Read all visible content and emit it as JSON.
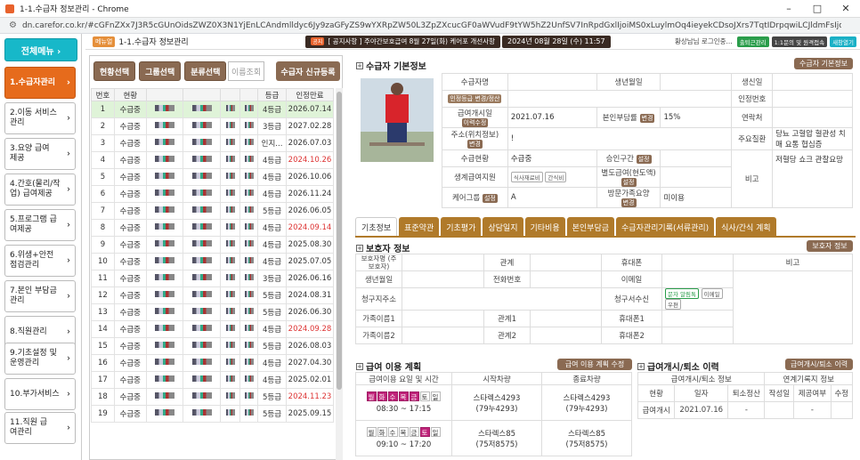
{
  "window": {
    "title": "1-1.수급자 정보관리 - Chrome",
    "url": "dn.carefor.co.kr/#cGFnZXx7J3R5cGUnOidsZWZ0X3N1YjEnLCAndmlldyc6Jy9zaGFyZS9wYXRpZW50L3ZpZXcucGF0aWVudF9tYW5hZ2UnfSV7InRpdGxlIjoiMS0xLuylmOq4ieyekCDsoJXrs7TqtIDrpqwiLCJldmFsIjoiNDciLCJnX3BhbW10nb..."
  },
  "sidebar": {
    "top_label": "전체메뉴 ›",
    "items": [
      {
        "label": "1.수급자관리",
        "active": true
      },
      {
        "label": "2.이동 서비스관리"
      },
      {
        "label": "3.요양 급여제공"
      },
      {
        "label": "4.간호(물리/작업) 급여제공"
      },
      {
        "label": "5.프로그램 급여제공"
      },
      {
        "label": "6.위생+안전 점검관리"
      },
      {
        "label": "7.본인 부담금관리"
      },
      {
        "label": "8.직원관리"
      },
      {
        "label": "9.기초설정 및 운영관리"
      },
      {
        "label": "10.부가서비스"
      },
      {
        "label": "11.직원 급여관리"
      }
    ]
  },
  "topbar": {
    "menu_badge": "메뉴얼",
    "title": "1-1.수급자 정보관리",
    "notice_icon": "공지",
    "notice": "[ 공지사항 ] 주야간보호급여 8월 27일(화) 케어포 개선사항",
    "clock": "2024년 08월 28일 (수) 11:57",
    "user": "황상남님 로그인중...",
    "btn1": "출퇴근관리",
    "btn2": "1:1문의 및 원격접속",
    "btn3": "새창열기"
  },
  "list": {
    "buttons": [
      "현황선택",
      "그룹선택",
      "분류선택"
    ],
    "search_placeholder": "이름조회",
    "new_button": "수급자 신규등록",
    "headers": [
      "번호",
      "현황",
      "",
      "",
      "",
      "",
      "등급",
      "인정만료"
    ],
    "rows": [
      {
        "no": "1",
        "status": "수급중",
        "grade": "4등급",
        "expire": "2026.07.14",
        "red": false
      },
      {
        "no": "2",
        "status": "수급중",
        "grade": "3등급",
        "expire": "2027.02.28",
        "red": false
      },
      {
        "no": "3",
        "status": "수급중",
        "grade": "인지...",
        "expire": "2026.07.03",
        "red": false
      },
      {
        "no": "4",
        "status": "수급중",
        "grade": "4등급",
        "expire": "2024.10.26",
        "red": true
      },
      {
        "no": "5",
        "status": "수급중",
        "grade": "4등급",
        "expire": "2026.10.06",
        "red": false
      },
      {
        "no": "6",
        "status": "수급중",
        "grade": "4등급",
        "expire": "2026.11.24",
        "red": false
      },
      {
        "no": "7",
        "status": "수급중",
        "grade": "5등급",
        "expire": "2026.06.05",
        "red": false
      },
      {
        "no": "8",
        "status": "수급중",
        "grade": "4등급",
        "expire": "2024.09.14",
        "red": true
      },
      {
        "no": "9",
        "status": "수급중",
        "grade": "4등급",
        "expire": "2025.08.30",
        "red": false
      },
      {
        "no": "10",
        "status": "수급중",
        "grade": "4등급",
        "expire": "2025.07.05",
        "red": false
      },
      {
        "no": "11",
        "status": "수급중",
        "grade": "3등급",
        "expire": "2026.06.16",
        "red": false
      },
      {
        "no": "12",
        "status": "수급중",
        "grade": "5등급",
        "expire": "2024.08.31",
        "red": false
      },
      {
        "no": "13",
        "status": "수급중",
        "grade": "5등급",
        "expire": "2026.06.30",
        "red": false
      },
      {
        "no": "14",
        "status": "수급중",
        "grade": "4등급",
        "expire": "2024.09.28",
        "red": true
      },
      {
        "no": "15",
        "status": "수급중",
        "grade": "5등급",
        "expire": "2026.08.03",
        "red": false
      },
      {
        "no": "16",
        "status": "수급중",
        "grade": "4등급",
        "expire": "2027.04.30",
        "red": false
      },
      {
        "no": "17",
        "status": "수급중",
        "grade": "4등급",
        "expire": "2025.02.01",
        "red": false
      },
      {
        "no": "18",
        "status": "수급중",
        "grade": "5등급",
        "expire": "2024.11.23",
        "red": true
      },
      {
        "no": "19",
        "status": "수급중",
        "grade": "5등급",
        "expire": "2025.09.15",
        "red": false
      }
    ]
  },
  "basic": {
    "title": "수급자 기본정보",
    "btn": "수급자 기본정보",
    "l_name": "수급자명",
    "l_birth": "생년월일",
    "l_sex": "생신일",
    "l_cert_btn": "인정등급 변경/정산",
    "l_certno": "인정번호",
    "l_startdate": "급여개시일",
    "btn_modify": "이력수정",
    "startdate": "2021.07.16",
    "l_copay": "본인부담률",
    "btn_change": "변경",
    "copay": "15%",
    "l_contact": "연락처",
    "l_addr": "주소(위치정보)",
    "addr": "!",
    "l_disease": "주요질환",
    "disease": "당뇨 고혈압 혈관성 치매 요통 협심증",
    "l_status": "수급현황",
    "status": "수급중",
    "l_approve": "승인구간",
    "btn_set": "설정",
    "l_note": "비고",
    "note": "저혈당 쇼크 관찰요망",
    "l_life": "생계급여지원",
    "btn_detail": "식사재료비",
    "btn_ganshik": "간식비",
    "l_special": "별도급여(현도액)",
    "btn_set2": "설정",
    "l_group": "케어그룹",
    "btn_group": "설정",
    "group": "A",
    "l_visit": "방문가족요양",
    "btn_visit": "변경",
    "visit": "미이용"
  },
  "tabs": [
    "기초정보",
    "표준약관",
    "기초평가",
    "상담일지",
    "기타비용",
    "본인부담금",
    "수급자관리기록(서류관리)",
    "식사/간식 계획"
  ],
  "guardian": {
    "title": "보호자 정보",
    "btn": "보호자 정보",
    "l_name": "보호자명\n(주보호자)",
    "l_rel": "관계",
    "l_phone": "휴대폰",
    "l_note": "비고",
    "l_birth": "생년월일",
    "l_tel": "전화번호",
    "l_email": "이메일",
    "l_billaddr": "청구지주소",
    "l_billrecv": "청구서수신",
    "r_sms": "문자 알림톡",
    "r_email": "이메일",
    "r_post": "우편",
    "l_fam1": "가족이름1",
    "l_rel1": "관계1",
    "l_phone1": "휴대폰1",
    "l_fam2": "가족이름2",
    "l_rel2": "관계2",
    "l_phone2": "휴대폰2"
  },
  "plan": {
    "title": "급여 이용 계획",
    "btn": "급여 이용 계획 수정",
    "h1": "급여이용 요일 및 시간",
    "h2": "시작차량",
    "h3": "종료차량",
    "days": [
      "월",
      "화",
      "수",
      "목",
      "금",
      "토",
      "일"
    ],
    "rows": [
      {
        "time": "08:30 ~ 17:15",
        "start": "스타렉스4293",
        "start2": "(79누4293)",
        "end": "스타렉스4293",
        "end2": "(79누4293)",
        "on": [
          true,
          true,
          true,
          true,
          true,
          false,
          false
        ]
      },
      {
        "time": "09:10 ~ 17:20",
        "start": "스타렉스85",
        "start2": "(75저8575)",
        "end": "스타렉스85",
        "end2": "(75저8575)",
        "on": [
          false,
          false,
          false,
          false,
          false,
          true,
          false
        ]
      }
    ]
  },
  "history": {
    "title": "급여개시/퇴소 이력",
    "btn": "급여개시/퇴소 이력",
    "h_a": "급여개시/퇴소 정보",
    "h_b": "연계기록지 정보",
    "c1": "현황",
    "c2": "일자",
    "c3": "퇴소정산",
    "c4": "작성일",
    "c5": "제공여부",
    "c6": "수정",
    "r_status": "급여개시",
    "r_date": "2021.07.16",
    "r_settle": "-",
    "r_prov": "-"
  }
}
